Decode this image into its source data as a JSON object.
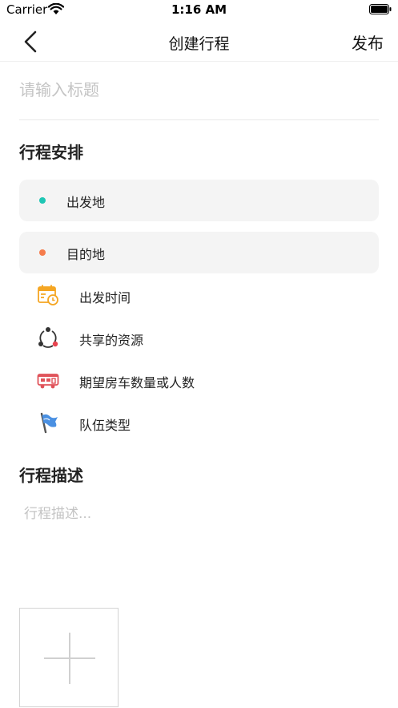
{
  "status_bar": {
    "carrier": "Carrier",
    "time": "1:16 AM"
  },
  "nav": {
    "title": "创建行程",
    "publish_label": "发布"
  },
  "title_input": {
    "value": "",
    "placeholder": "请输入标题"
  },
  "itinerary": {
    "heading": "行程安排",
    "departure": {
      "label": "出发地",
      "dot_color": "#1ec6b4"
    },
    "destination": {
      "label": "目的地",
      "dot_color": "#f57c4c"
    },
    "options": [
      {
        "label": "出发时间",
        "icon": "calendar-clock-icon"
      },
      {
        "label": "共享的资源",
        "icon": "share-nodes-icon"
      },
      {
        "label": "期望房车数量或人数",
        "icon": "rv-icon"
      },
      {
        "label": "队伍类型",
        "icon": "flag-icon"
      }
    ]
  },
  "description": {
    "heading": "行程描述",
    "value": "",
    "placeholder": "行程描述..."
  },
  "colors": {
    "card_bg": "#f4f4f4",
    "accent_teal": "#1ec6b4",
    "accent_orange": "#f57c4c"
  }
}
